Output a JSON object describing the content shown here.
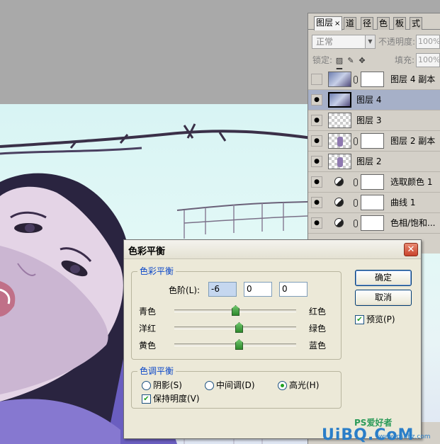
{
  "layers_panel": {
    "tabs": [
      "图层",
      "×",
      "道",
      "径",
      "色",
      "板",
      "式"
    ],
    "blend_mode": "正常",
    "opacity_label": "不透明度:",
    "opacity_value": "100%",
    "lock_label": "锁定:",
    "fill_label": "填充:",
    "fill_value": "100%",
    "layers": [
      {
        "name": "图层 4 副本",
        "visible": false,
        "type": "photo-mask"
      },
      {
        "name": "图层 4",
        "visible": true,
        "type": "photo",
        "selected": true
      },
      {
        "name": "图层 3",
        "visible": true,
        "type": "checker"
      },
      {
        "name": "图层 2 副本",
        "visible": true,
        "type": "checker-mask"
      },
      {
        "name": "图层 2",
        "visible": true,
        "type": "checker"
      },
      {
        "name": "选取颜色 1",
        "visible": true,
        "type": "adjustment"
      },
      {
        "name": "曲线 1",
        "visible": true,
        "type": "adjustment"
      },
      {
        "name": "色相/饱和...",
        "visible": true,
        "type": "adjustment"
      }
    ]
  },
  "dialog": {
    "title": "色彩平衡",
    "color_balance_group": "色彩平衡",
    "levels_label": "色阶(L):",
    "levels": [
      "-6",
      "0",
      "0"
    ],
    "sliders": [
      {
        "left": "青色",
        "right": "红色",
        "value": -6
      },
      {
        "left": "洋红",
        "right": "绿色",
        "value": 0
      },
      {
        "left": "黄色",
        "right": "蓝色",
        "value": 0
      }
    ],
    "tone_group": "色调平衡",
    "tones": [
      {
        "label": "阴影(S)",
        "selected": false
      },
      {
        "label": "中间调(D)",
        "selected": false
      },
      {
        "label": "高光(H)",
        "selected": true
      }
    ],
    "preserve_luminosity": "保持明度(V)",
    "preserve_checked": true,
    "ok_button": "确定",
    "cancel_button": "取消",
    "preview_label": "预览(P)",
    "preview_checked": true
  },
  "watermark": {
    "brand": "PS爱好者",
    "site": "UiBQ.CoM",
    "url": "www.psahz.com"
  }
}
